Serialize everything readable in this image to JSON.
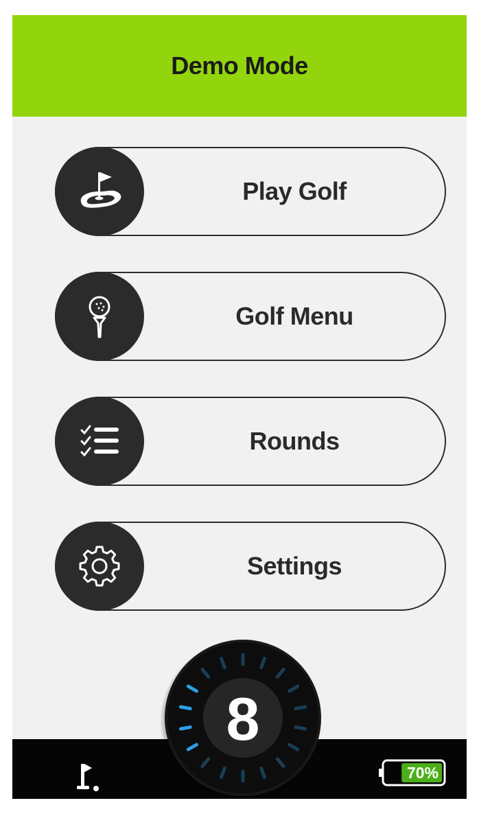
{
  "header": {
    "title": "Demo Mode"
  },
  "menu": {
    "items": [
      {
        "label": "Play Golf",
        "icon": "putting-green-flag-icon"
      },
      {
        "label": "Golf Menu",
        "icon": "golf-ball-on-tee-icon"
      },
      {
        "label": "Rounds",
        "icon": "checklist-icon"
      },
      {
        "label": "Settings",
        "icon": "gear-icon"
      }
    ]
  },
  "dial": {
    "value": "8",
    "active_color": "#2aa0e6"
  },
  "status": {
    "battery": "70%",
    "battery_level": 0.7,
    "course_icon": "golf-flag-icon"
  },
  "colors": {
    "accent": "#93d50c",
    "dark": "#2b2b2b",
    "background": "#f1f1f1"
  }
}
